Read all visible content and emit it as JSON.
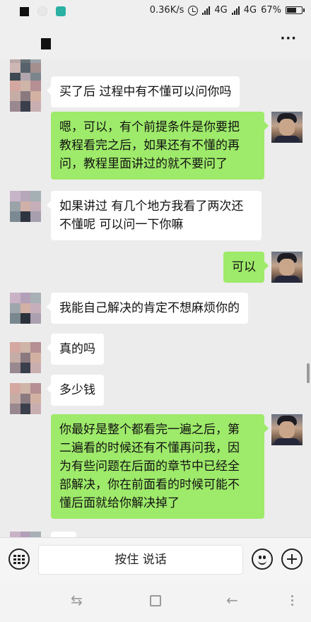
{
  "status_bar": {
    "network_speed": "0.36K/s",
    "sim1_type": "4G",
    "sim2_type": "4G",
    "battery": "67%",
    "battery_fraction": 0.67
  },
  "header": {
    "title": "",
    "more_label": "···"
  },
  "messages": [
    {
      "side": "left",
      "text": "买了后 过程中有不懂可以问你吗"
    },
    {
      "side": "right",
      "lines": [
        "嗯，可以，有个前提条件是你要把",
        "教程看完之后，如果还有不懂的再",
        "问，教程里面讲过的就不要问了"
      ]
    },
    {
      "side": "left",
      "lines": [
        "如果讲过 有几个地方我看了两次还",
        "不懂呢 可以问一下你嘛"
      ]
    },
    {
      "side": "right",
      "text": "可以"
    },
    {
      "side": "left",
      "text": "我能自己解决的肯定不想麻烦你的"
    },
    {
      "side": "left",
      "text": "真的吗"
    },
    {
      "side": "left",
      "text": "多少钱"
    },
    {
      "side": "right",
      "lines": [
        "你最好是整个都看完一遍之后，第",
        "二遍看的时候还有不懂再问我，因",
        "为有些问题在后面的章节中已经全",
        "部解决，你在前面看的时候可能不",
        "懂后面就给你解决掉了"
      ]
    }
  ],
  "input_bar": {
    "hold_to_talk": "按住 说话"
  },
  "nav_bar": {
    "back_glyph": "⇆",
    "home_glyph": "←"
  },
  "colors": {
    "chat_bg": "#ececec",
    "sent_bubble": "#9eea6a",
    "received_bubble": "#ffffff"
  }
}
